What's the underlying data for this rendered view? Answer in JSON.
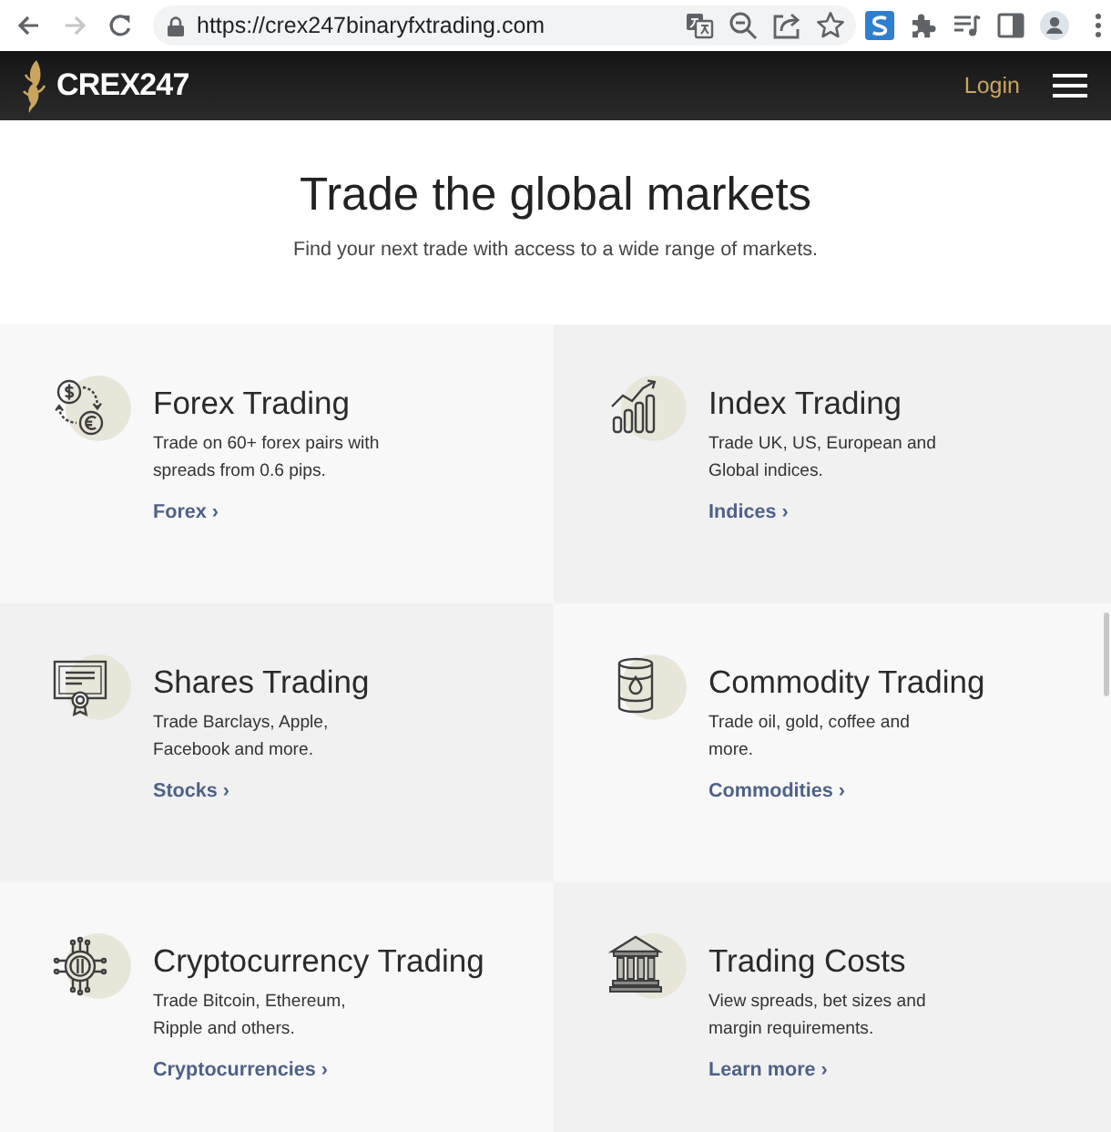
{
  "browser": {
    "nav_buttons": [
      {
        "kind": "back",
        "disabled": false
      },
      {
        "kind": "forward",
        "disabled": true
      },
      {
        "kind": "reload",
        "disabled": false
      }
    ],
    "url": "https://crex247binaryfxtrading.com"
  },
  "header": {
    "logo": "CREX247",
    "login": "Login"
  },
  "hero": {
    "title": "Trade the global markets",
    "subtitle": "Find your next trade with access to a wide range of markets."
  },
  "markets": [
    {
      "kind": "forex",
      "title": "Forex Trading",
      "description_lines": [
        "Trade on 60+ forex pairs with",
        "spreads from 0.6 pips."
      ],
      "link": "Forex ›"
    },
    {
      "kind": "index",
      "title": "Index Trading",
      "description_lines": [
        "Trade UK, US, European and",
        "Global indices."
      ],
      "link": "Indices ›"
    },
    {
      "kind": "shares",
      "title": "Shares Trading",
      "description_lines": [
        "Trade Barclays, Apple,",
        "Facebook and more."
      ],
      "link": "Stocks ›"
    },
    {
      "kind": "commodity",
      "title": "Commodity Trading",
      "description_lines": [
        "Trade oil, gold, coffee and",
        "more."
      ],
      "link": "Commodities ›"
    },
    {
      "kind": "crypto",
      "title": "Cryptocurrency Trading",
      "description_lines": [
        "Trade Bitcoin, Ethereum,",
        "Ripple and others."
      ],
      "link": "Cryptocurrencies ›"
    },
    {
      "kind": "costs",
      "title": "Trading Costs",
      "description_lines": [
        "View spreads, bet sizes and",
        "margin requirements."
      ],
      "link": "Learn more ›"
    }
  ]
}
